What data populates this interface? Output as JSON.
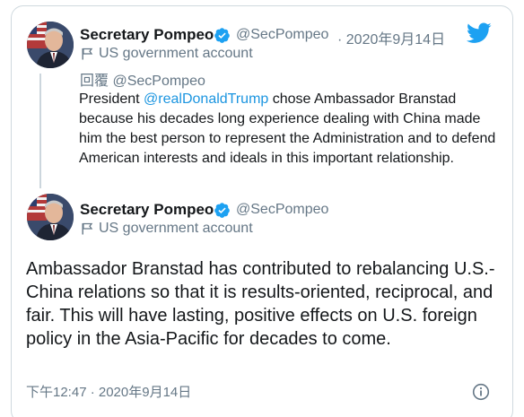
{
  "colors": {
    "accent": "#1da1f2",
    "link": "#1b95e0",
    "muted": "#657786",
    "text": "#14171a",
    "border": "#cfd9de"
  },
  "icons": {
    "brand": "twitter-bird-icon",
    "verified": "verified-badge-icon",
    "government": "flag-icon",
    "info": "info-icon"
  },
  "parent_tweet": {
    "author_name": "Secretary Pompeo",
    "handle": "@SecPompeo",
    "date": "· 2020年9月14日",
    "label": "US government account",
    "reply_prefix": "回覆",
    "reply_handle": "@SecPompeo",
    "text_before": "President ",
    "mention": "@realDonaldTrump",
    "text_after": " chose Ambassador Branstad because his decades long experience dealing with China made him the best person to represent the Administration and to defend American interests and ideals in this important relationship."
  },
  "main_tweet": {
    "author_name": "Secretary Pompeo",
    "handle": "@SecPompeo",
    "label": "US government account",
    "text": "Ambassador Branstad has contributed to rebalancing U.S.-China relations so that it is results-oriented, reciprocal, and fair. This will have lasting, positive effects on U.S. foreign policy in the Asia-Pacific for decades to come.",
    "timestamp": "下午12:47 · 2020年9月14日"
  }
}
